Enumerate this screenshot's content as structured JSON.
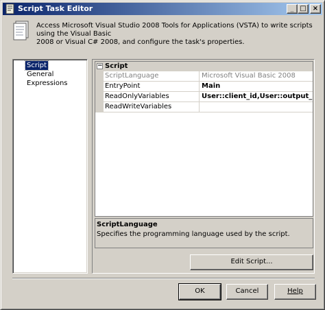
{
  "window": {
    "title": "Script Task Editor",
    "minimize_glyph": "_",
    "maximize_glyph": "□",
    "close_glyph": "×"
  },
  "header": {
    "line1": "Access Microsoft Visual Studio 2008 Tools for Applications (VSTA) to write scripts using the Visual Basic",
    "line2": "2008 or Visual C# 2008, and configure the task's properties."
  },
  "nav": {
    "items": [
      {
        "label": "Script",
        "selected": true
      },
      {
        "label": "General",
        "selected": false
      },
      {
        "label": "Expressions",
        "selected": false
      }
    ]
  },
  "property_grid": {
    "category": "Script",
    "expander_glyph": "−",
    "rows": [
      {
        "name": "ScriptLanguage",
        "value": "Microsoft Visual Basic 2008",
        "readonly": true,
        "bold": false
      },
      {
        "name": "EntryPoint",
        "value": "Main",
        "readonly": false,
        "bold": true
      },
      {
        "name": "ReadOnlyVariables",
        "value": "User::client_id,User::output_path",
        "readonly": false,
        "bold": true
      },
      {
        "name": "ReadWriteVariables",
        "value": "",
        "readonly": false,
        "bold": false
      }
    ]
  },
  "description": {
    "title": "ScriptLanguage",
    "text": "Specifies the programming language used by the script."
  },
  "buttons": {
    "edit_script": "Edit Script...",
    "ok": "OK",
    "cancel": "Cancel",
    "help": "Help"
  },
  "colors": {
    "titlebar_start": "#0a246a",
    "titlebar_end": "#a6caf0",
    "face": "#d4d0c8",
    "selection": "#0a246a"
  }
}
